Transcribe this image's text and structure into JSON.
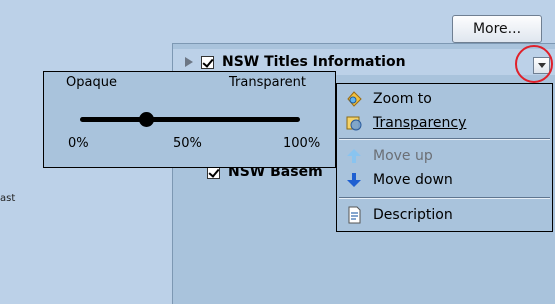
{
  "background_edge_text": "ast",
  "toolbar": {
    "more_label": "More..."
  },
  "layers": [
    {
      "name": "NSW Titles Information",
      "checked": true
    },
    {
      "name": "NSW Basem",
      "checked": true
    }
  ],
  "transparency_popup": {
    "left_label": "Opaque",
    "right_label": "Transparent",
    "ticks": [
      "0%",
      "50%",
      "100%"
    ],
    "value_percent": 30
  },
  "context_menu": {
    "items": [
      {
        "label": "Zoom to",
        "icon": "zoom-to-icon",
        "enabled": true
      },
      {
        "label": "Transparency",
        "icon": "transparency-icon",
        "enabled": true
      },
      {
        "label": "Move up",
        "icon": "arrow-up-icon",
        "enabled": false
      },
      {
        "label": "Move down",
        "icon": "arrow-down-icon",
        "enabled": true
      },
      {
        "label": "Description",
        "icon": "document-icon",
        "enabled": true
      }
    ]
  },
  "colors": {
    "accent_red": "#e0202a",
    "panel": "#a9c3dc",
    "background": "#bcd1e8",
    "arrow_blue": "#1e5fd1"
  }
}
